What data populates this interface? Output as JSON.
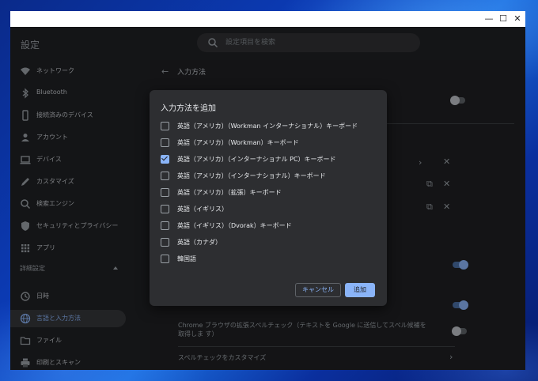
{
  "window": {
    "minimize": "—",
    "maximize": "☐",
    "close": "✕"
  },
  "header": {
    "title": "設定",
    "search_placeholder": "設定項目を検索"
  },
  "sidebar": {
    "items": [
      {
        "label": "ネットワーク",
        "icon": "wifi-icon"
      },
      {
        "label": "Bluetooth",
        "icon": "bluetooth-icon"
      },
      {
        "label": "接続済みのデバイス",
        "icon": "phone-icon"
      },
      {
        "label": "アカウント",
        "icon": "person-icon"
      },
      {
        "label": "デバイス",
        "icon": "laptop-icon"
      },
      {
        "label": "カスタマイズ",
        "icon": "pencil-icon"
      },
      {
        "label": "検索エンジン",
        "icon": "search-icon"
      },
      {
        "label": "セキュリティとプライバシー",
        "icon": "shield-icon"
      },
      {
        "label": "アプリ",
        "icon": "apps-grid-icon"
      }
    ],
    "advanced_label": "詳細設定",
    "advanced_items": [
      {
        "label": "日時",
        "icon": "clock-icon"
      },
      {
        "label": "言語と入力方法",
        "icon": "globe-icon",
        "active": true
      },
      {
        "label": "ファイル",
        "icon": "folder-icon"
      },
      {
        "label": "印刷とスキャン",
        "icon": "printer-icon"
      }
    ]
  },
  "main": {
    "back_label": "←",
    "title": "入力方法",
    "spell_row": "Chrome ブラウザの拡張スペルチェック（テキストを Google に送信してスペル候補を取得しま す）",
    "customize_spell": "スペルチェックをカスタマイズ",
    "chevron": "›"
  },
  "dialog": {
    "title": "入力方法を追加",
    "options": [
      {
        "label": "英語（アメリカ）（Workman インターナショナル）キーボード",
        "checked": false
      },
      {
        "label": "英語（アメリカ）（Workman）キーボード",
        "checked": false
      },
      {
        "label": "英語（アメリカ）（インターナショナル PC）キーボード",
        "checked": true
      },
      {
        "label": "英語（アメリカ）（インターナショナル）キーボード",
        "checked": false
      },
      {
        "label": "英語（アメリカ）（拡張）キーボード",
        "checked": false
      },
      {
        "label": "英語（イギリス）",
        "checked": false
      },
      {
        "label": "英語（イギリス）（Dvorak）キーボード",
        "checked": false
      },
      {
        "label": "英語（カナダ）",
        "checked": false
      },
      {
        "label": "韓国語",
        "checked": false
      }
    ],
    "cancel_label": "キャンセル",
    "add_label": "追加"
  },
  "colors": {
    "accent": "#8ab4f8",
    "background": "#202124"
  }
}
